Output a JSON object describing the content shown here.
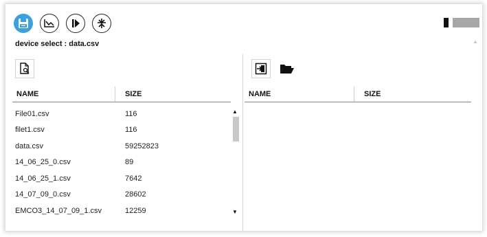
{
  "toolbar": {
    "tools": [
      {
        "icon": "save-disk-icon",
        "active": true,
        "color": "#3aa0e0"
      },
      {
        "icon": "chart-down-icon",
        "active": false
      },
      {
        "icon": "play-step-icon",
        "active": false
      },
      {
        "icon": "network-icon",
        "active": false
      }
    ]
  },
  "device_select_label": "device select : data.csv",
  "slider": {
    "value_fraction": 0.2
  },
  "left_panel": {
    "icon": "document-search-icon",
    "columns": {
      "name": "NAME",
      "size": "SIZE"
    },
    "files": [
      {
        "name": "File01.csv",
        "size": "116"
      },
      {
        "name": "filet1.csv",
        "size": "116"
      },
      {
        "name": "data.csv",
        "size": "59252823"
      },
      {
        "name": "14_06_25_0.csv",
        "size": "89"
      },
      {
        "name": "14_06_25_1.csv",
        "size": "7642"
      },
      {
        "name": "14_07_09_0.csv",
        "size": "28602"
      },
      {
        "name": "EMCO3_14_07_09_1.csv",
        "size": "12259"
      }
    ]
  },
  "right_panel": {
    "icons": [
      "import-icon",
      "open-folder-icon"
    ],
    "columns": {
      "name": "NAME",
      "size": "SIZE"
    }
  }
}
